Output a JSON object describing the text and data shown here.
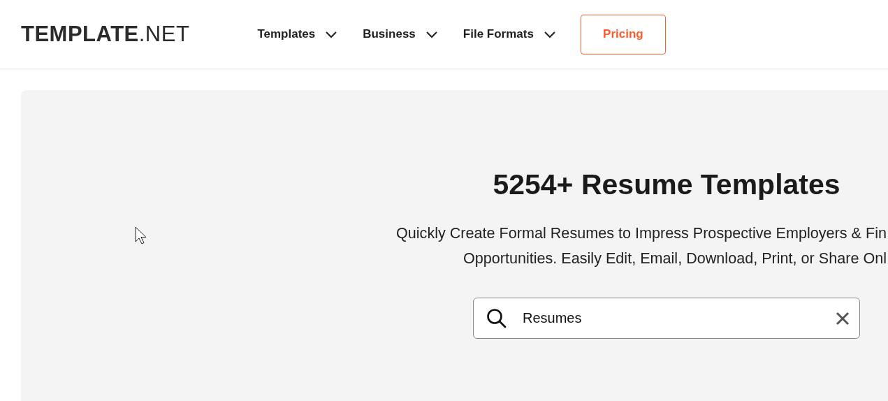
{
  "header": {
    "logo": "**TEMPLATE**.NET",
    "nav": [
      {
        "label": "Templates"
      },
      {
        "label": "Business"
      },
      {
        "label": "File Formats"
      }
    ],
    "pricing_button": "Pricing"
  },
  "hero": {
    "title": "5254+ Resume Templates",
    "subtitle_lines": [
      "Quickly Create Formal Resumes to Impress Prospective Employers & Fin",
      "Opportunities. Easily Edit, Email, Download, Print, or Share Onl"
    ],
    "search": {
      "value": "Resumes"
    }
  }
}
